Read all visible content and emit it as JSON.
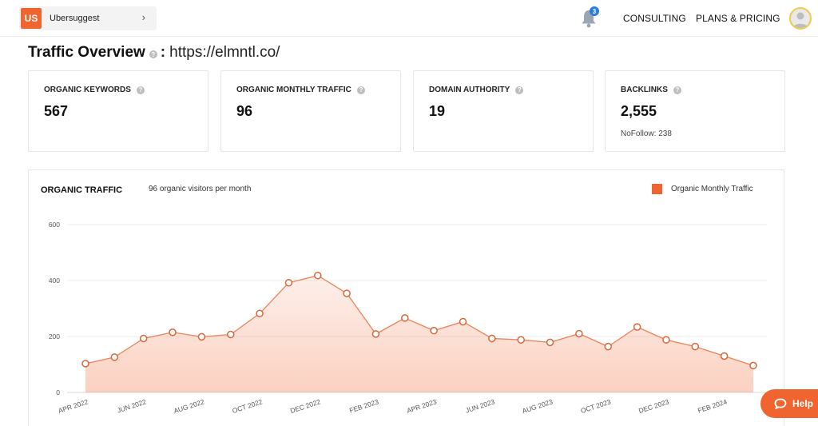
{
  "topbar": {
    "project_badge": "US",
    "project_name": "Ubersuggest",
    "chevron": "›",
    "notification_count": "3",
    "nav": [
      "CONSULTING",
      "PLANS & PRICING"
    ],
    "icons": {
      "bell": "bell-icon",
      "avatar": "user-avatar",
      "chevron": "chevron-right-icon"
    }
  },
  "page": {
    "title": "Traffic Overview",
    "colon": ":",
    "url": "https://elmntl.co/"
  },
  "help_glyph": "?",
  "cards": [
    {
      "label": "ORGANIC KEYWORDS",
      "value": "567",
      "sub": ""
    },
    {
      "label": "ORGANIC MONTHLY TRAFFIC",
      "value": "96",
      "sub": ""
    },
    {
      "label": "DOMAIN AUTHORITY",
      "value": "19",
      "sub": ""
    },
    {
      "label": "BACKLINKS",
      "value": "2,555",
      "sub": "NoFollow: 238"
    }
  ],
  "chart": {
    "title": "ORGANIC TRAFFIC",
    "subtitle": "96 organic visitors per month",
    "legend": "Organic Monthly Traffic"
  },
  "chart_data": {
    "type": "area",
    "title": "ORGANIC TRAFFIC",
    "subtitle": "96 organic visitors per month",
    "legend_position": "top-right",
    "grid": true,
    "ylim": [
      0,
      600
    ],
    "yticks": [
      0,
      200,
      400,
      600
    ],
    "x": [
      "Apr 2022",
      "May 2022",
      "Jun 2022",
      "Jul 2022",
      "Aug 2022",
      "Sep 2022",
      "Oct 2022",
      "Nov 2022",
      "Dec 2022",
      "Jan 2023",
      "Feb 2023",
      "Mar 2023",
      "Apr 2023",
      "May 2023",
      "Jun 2023",
      "Jul 2023",
      "Aug 2023",
      "Sep 2023",
      "Oct 2023",
      "Nov 2023",
      "Dec 2023",
      "Jan 2024",
      "Feb 2024",
      "Mar 2024"
    ],
    "xtick_labels": [
      "APR 2022",
      "JUN 2022",
      "AUG 2022",
      "OCT 2022",
      "DEC 2022",
      "FEB 2023",
      "APR 2023",
      "JUN 2023",
      "AUG 2023",
      "OCT 2023",
      "DEC 2023",
      "FEB 2024"
    ],
    "xtick_indices": [
      0,
      2,
      4,
      6,
      8,
      10,
      12,
      14,
      16,
      18,
      20,
      22
    ],
    "series": [
      {
        "name": "Organic Monthly Traffic",
        "color": "#f0652f",
        "values": [
          103,
          126,
          193,
          215,
          199,
          207,
          282,
          392,
          418,
          354,
          209,
          266,
          221,
          253,
          193,
          188,
          179,
          210,
          164,
          234,
          188,
          164,
          130,
          96
        ]
      }
    ]
  },
  "help": {
    "label": "Help",
    "icon": "chat-bubble-icon"
  }
}
